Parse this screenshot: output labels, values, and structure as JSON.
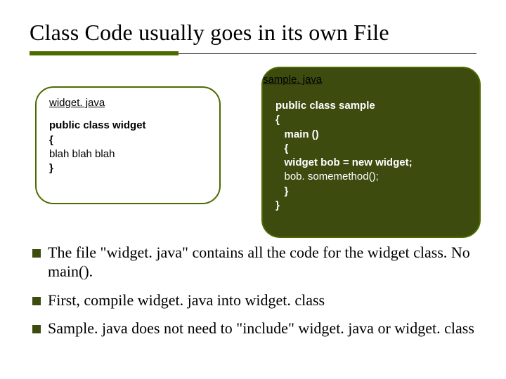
{
  "title": "Class Code usually goes in its own File",
  "left_box": {
    "filename": "widget. java",
    "line1": "public class widget",
    "line2": "{",
    "line3": "blah blah blah",
    "line4": "}"
  },
  "right_box": {
    "filename": "sample. java",
    "line1": "public class sample",
    "line2": "{",
    "line3": "   main ()",
    "line4": "   {",
    "line5": "   widget bob = new widget;",
    "line6": "   bob. somemethod();",
    "line7": "   }",
    "line8": "}"
  },
  "bullets": [
    "The file \"widget. java\" contains all the code for the widget class.  No main().",
    "First, compile widget. java into widget. class",
    "Sample. java does not need to \"include\" widget. java or widget. class"
  ]
}
